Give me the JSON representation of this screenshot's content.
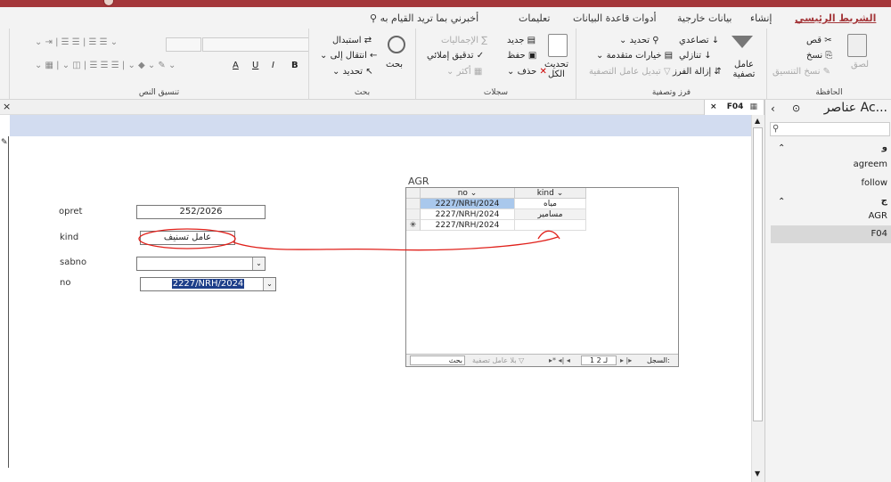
{
  "menu": {
    "tabs": [
      "الشريط الرئيسي",
      "إنشاء",
      "بيانات خارجية",
      "أدوات قاعدة البيانات",
      "تعليمات"
    ],
    "tell_me": "أخبرني بما تريد القيام به"
  },
  "ribbon": {
    "clipboard": {
      "label": "الحافظة",
      "cut": "قص",
      "copy": "نسخ",
      "paste": "لصق",
      "format_painter": "نسخ التنسيق"
    },
    "sort_filter": {
      "label": "فرز وتصفية",
      "filter": "عامل تصفية",
      "ascending": "تصاعدي",
      "descending": "تنازلي",
      "remove_sort": "إزالة الفرز",
      "selection": "تحديد",
      "advanced": "خيارات متقدمة",
      "toggle_filter": "تبديل عامل التصفية"
    },
    "records": {
      "label": "سجلات",
      "refresh": "تحديث الكل",
      "new": "جديد",
      "save": "حفظ",
      "delete": "حذف",
      "totals": "الإجماليات",
      "spelling": "تدقيق إملائي",
      "more": "أكثر"
    },
    "find": {
      "label": "بحث",
      "find": "بحث",
      "replace": "استبدال",
      "goto": "انتقال إلى",
      "select": "تحديد"
    },
    "text_format": {
      "label": "تنسيق النص",
      "bold": "B",
      "italic": "I",
      "underline": "U",
      "font_color": "A"
    }
  },
  "document": {
    "tab": "F04"
  },
  "form": {
    "fields": [
      {
        "label": "opret",
        "value": "252/2026"
      },
      {
        "label": "kind",
        "value": "عامل تسنيف"
      },
      {
        "label": "sabno",
        "value": ""
      },
      {
        "label": "no",
        "value": "2227/NRH/2024"
      }
    ],
    "subform": {
      "title": "AGR",
      "columns": [
        "no",
        "kind"
      ],
      "rows": [
        {
          "no": "2227/NRH/2024",
          "kind": "مياه"
        },
        {
          "no": "2227/NRH/2024",
          "kind": "مسامير"
        },
        {
          "no": "2227/NRH/2024",
          "kind": ""
        }
      ],
      "nav": {
        "record_label": "السجل:",
        "record": "1 لـ 2",
        "no_filter": "بلا عامل تصفية",
        "search": "بحث"
      }
    }
  },
  "nav_pane": {
    "title": "عناصر Ac...",
    "groups": [
      {
        "name": "و",
        "items": [
          "agreem",
          "follow"
        ]
      },
      {
        "name": "ج",
        "items": [
          "AGR",
          "F04"
        ]
      }
    ],
    "selected": "F04"
  },
  "annotation": {
    "color": "#e0201a"
  }
}
